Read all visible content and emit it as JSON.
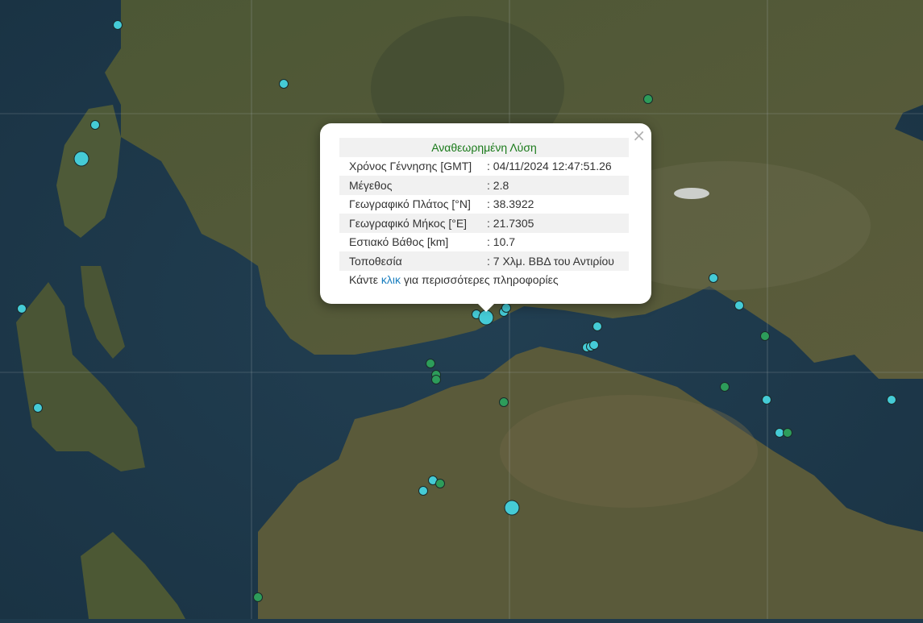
{
  "popup": {
    "title": "Αναθεωρημένη Λύση",
    "close_symbol": "×",
    "rows": [
      {
        "label": "Χρόνος Γέννησης [GMT]",
        "value": ": 04/11/2024 12:47:51.26"
      },
      {
        "label": "Μέγεθος",
        "value": ": 2.8"
      },
      {
        "label": "Γεωγραφικό Πλάτος [°N]",
        "value": ": 38.3922"
      },
      {
        "label": "Γεωγραφικό Μήκος [°E]",
        "value": ": 21.7305"
      },
      {
        "label": "Εστιακό Βάθος [km]",
        "value": ": 10.7"
      },
      {
        "label": "Τοποθεσία",
        "value": ": 7 Χλμ. ΒΒΔ του Αντιρίου"
      }
    ],
    "more_prefix": "Κάντε ",
    "more_link": "κλικ",
    "more_suffix": " για περισσότερες πληροφορίες"
  },
  "marker_colors": {
    "cyan": "#45cbd6",
    "green": "#2d9c5a"
  },
  "map_colors": {
    "sea": "#1f3a4d",
    "land": "#4d5a36",
    "forest": "#3d4a2a"
  }
}
